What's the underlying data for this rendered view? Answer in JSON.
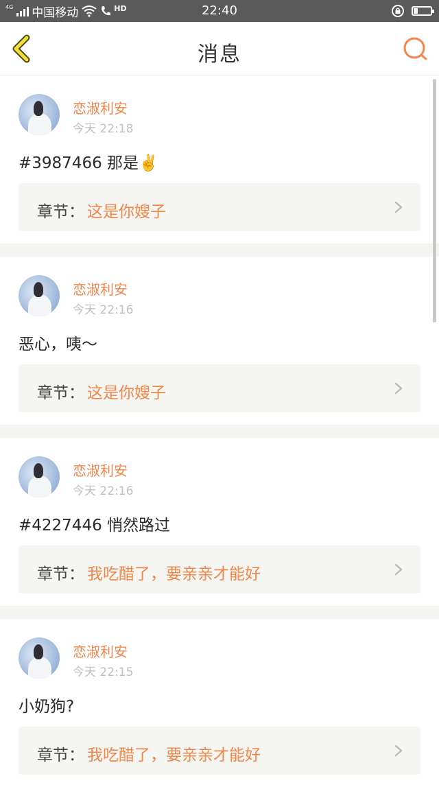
{
  "status_bar": {
    "network_tag": "4G",
    "carrier": "中国移动",
    "hd_label": "HD",
    "time": "22:40"
  },
  "header": {
    "title": "消息",
    "accent_color": "#f0864a",
    "back_icon": "chevron-left-icon",
    "search_icon": "search-icon"
  },
  "messages": [
    {
      "username": "恋淑利安",
      "timestamp": "今天 22:18",
      "text": "#3987466 那是✌️",
      "chapter_prefix": "章节：",
      "chapter_name": "这是你嫂子"
    },
    {
      "username": "恋淑利安",
      "timestamp": "今天 22:16",
      "text": "恶心，咦～",
      "chapter_prefix": "章节：",
      "chapter_name": "这是你嫂子"
    },
    {
      "username": "恋淑利安",
      "timestamp": "今天 22:16",
      "text": "#4227446 悄然路过",
      "chapter_prefix": "章节：",
      "chapter_name": "我吃醋了，要亲亲才能好"
    },
    {
      "username": "恋淑利安",
      "timestamp": "今天 22:15",
      "text": "小奶狗?",
      "chapter_prefix": "章节：",
      "chapter_name": "我吃醋了，要亲亲才能好"
    }
  ]
}
